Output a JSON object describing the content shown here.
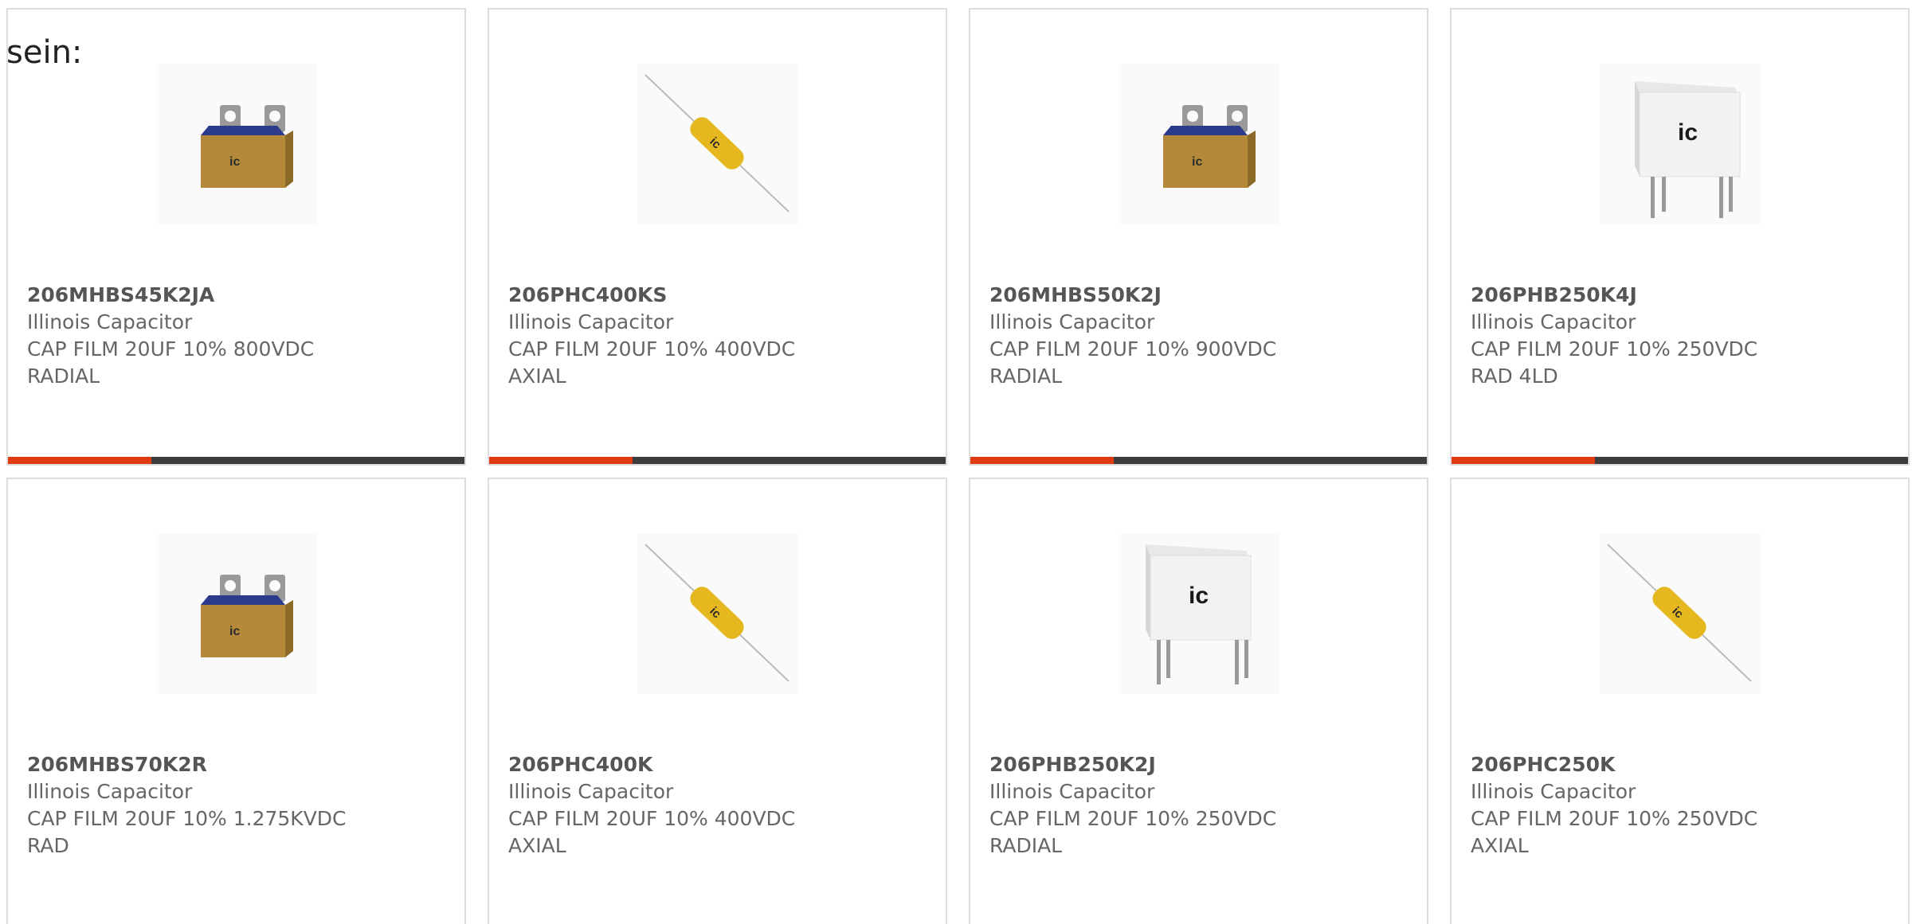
{
  "intro_text": "sein:",
  "accent_color": "#e03a12",
  "bar_color": "#3d3d3d",
  "products": [
    {
      "part": "206MHBS45K2JA",
      "maker": "Illinois Capacitor",
      "desc": "CAP FILM 20UF 10% 800VDC",
      "package": "RADIAL",
      "image": "box-capacitor-icon"
    },
    {
      "part": "206PHC400KS",
      "maker": "Illinois Capacitor",
      "desc": "CAP FILM 20UF 10% 400VDC",
      "package": "AXIAL",
      "image": "axial-capacitor-icon"
    },
    {
      "part": "206MHBS50K2J",
      "maker": "Illinois Capacitor",
      "desc": "CAP FILM 20UF 10% 900VDC",
      "package": "RADIAL",
      "image": "box-capacitor-icon"
    },
    {
      "part": "206PHB250K4J",
      "maker": "Illinois Capacitor",
      "desc": "CAP FILM 20UF 10% 250VDC",
      "package": "RAD 4LD",
      "image": "white-radial-capacitor-icon"
    },
    {
      "part": "206MHBS70K2R",
      "maker": "Illinois Capacitor",
      "desc": "CAP FILM 20UF 10% 1.275KVDC",
      "package": "RAD",
      "image": "box-capacitor-icon"
    },
    {
      "part": "206PHC400K",
      "maker": "Illinois Capacitor",
      "desc": "CAP FILM 20UF 10% 400VDC",
      "package": "AXIAL",
      "image": "axial-capacitor-icon"
    },
    {
      "part": "206PHB250K2J",
      "maker": "Illinois Capacitor",
      "desc": "CAP FILM 20UF 10% 250VDC",
      "package": "RADIAL",
      "image": "white-radial-capacitor-icon"
    },
    {
      "part": "206PHC250K",
      "maker": "Illinois Capacitor",
      "desc": "CAP FILM 20UF 10% 250VDC",
      "package": "AXIAL",
      "image": "axial-capacitor-icon"
    }
  ]
}
